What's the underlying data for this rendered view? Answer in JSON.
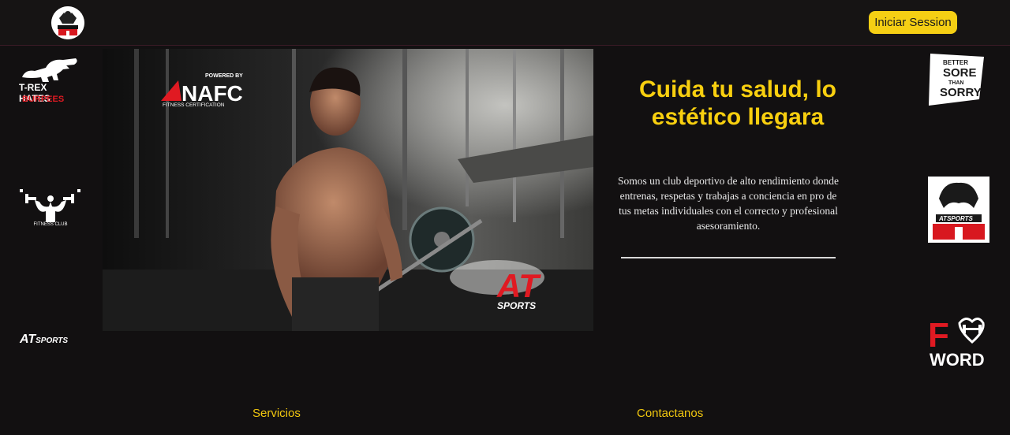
{
  "header": {
    "login_label": "Iniciar Session",
    "logo_name": "AT Sports badge"
  },
  "left_logos": {
    "trex_line1": "T-REX HATES",
    "trex_line2": "BURPEES",
    "fitness_club": "FITNESS CLUB",
    "at_sports_text_a": "AT",
    "at_sports_text_b": "SPORTS"
  },
  "hero": {
    "nafc_powered": "POWERED BY",
    "nafc_name": "NAFC",
    "nafc_sub": "FITNESS CERTIFICATION",
    "watermark_a": "AT",
    "watermark_b": "SPORTS"
  },
  "right_logos": {
    "better_l1": "BETTER",
    "better_l2": "SORE",
    "better_l3": "THAN",
    "better_l4": "SORRY",
    "at_badge_text": "ATSPORTS",
    "fword_f": "F",
    "fword_word": "WORD"
  },
  "content": {
    "headline": "Cuida tu salud, lo estético llegara",
    "description": "Somos un club deportivo de alto rendimiento donde entrenas, respetas y trabajas a conciencia en pro de tus metas individuales con el correcto y profesional asesoramiento."
  },
  "footer": {
    "services_label": "Servicios",
    "contact_label": "Contactanos"
  },
  "colors": {
    "accent": "#f5cf14",
    "background": "#121011",
    "brand_red": "#e01a22"
  }
}
